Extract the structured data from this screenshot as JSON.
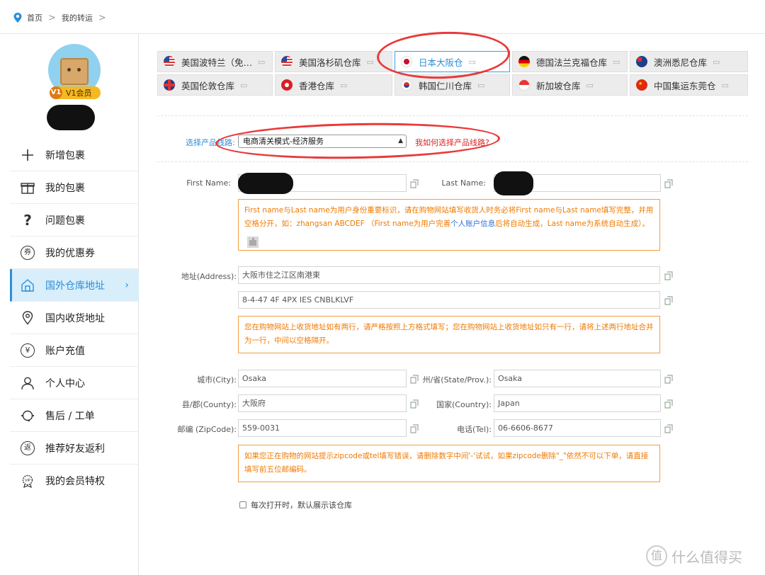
{
  "breadcrumb": {
    "home": "首页",
    "current": "我的转运"
  },
  "user": {
    "vip_badge": "V1会员",
    "vip_letter": "V1"
  },
  "sidebar": {
    "items": [
      {
        "label": "新增包裹",
        "icon": "plus-icon"
      },
      {
        "label": "我的包裹",
        "icon": "gift-box-icon"
      },
      {
        "label": "问题包裹",
        "icon": "question-icon"
      },
      {
        "label": "我的优惠券",
        "icon": "coupon-icon",
        "glyph": "券"
      },
      {
        "label": "国外仓库地址",
        "icon": "warehouse-icon",
        "active": true
      },
      {
        "label": "国内收货地址",
        "icon": "location-icon"
      },
      {
        "label": "账户充值",
        "icon": "yen-icon",
        "glyph": "¥"
      },
      {
        "label": "个人中心",
        "icon": "user-icon"
      },
      {
        "label": "售后 / 工单",
        "icon": "headset-icon"
      },
      {
        "label": "推荐好友返利",
        "icon": "rebate-icon",
        "glyph": "返"
      },
      {
        "label": "我的会员特权",
        "icon": "vip-badge-icon"
      }
    ]
  },
  "tabs": [
    {
      "label": "美国波特兰（免…",
      "flag": "us"
    },
    {
      "label": "美国洛杉矶仓库",
      "flag": "us"
    },
    {
      "label": "日本大阪仓",
      "flag": "jp",
      "active": true
    },
    {
      "label": "德国法兰克福仓库",
      "flag": "de"
    },
    {
      "label": "澳洲悉尼仓库",
      "flag": "au"
    },
    {
      "label": "英国伦敦仓库",
      "flag": "uk"
    },
    {
      "label": "香港仓库",
      "flag": "hk"
    },
    {
      "label": "韩国仁川仓库",
      "flag": "kr"
    },
    {
      "label": "新加坡仓库",
      "flag": "sg"
    },
    {
      "label": "中国集运东莞仓",
      "flag": "cn"
    }
  ],
  "product_line": {
    "label": "选择产品线路:",
    "selected": "电商清关模式-经济服务",
    "help_link": "我如何选择产品线路?"
  },
  "form": {
    "first_name_label": "First Name:",
    "last_name_label": "Last Name:",
    "name_note_1": "First name与Last name为用户身份重要标识，请在购物网站填写收货人时务必将First name与Last name填写完整，并用空格分开，如：zhangsan ABCDEF （First name为用户完善",
    "name_note_link": "个人账户信息",
    "name_note_2": "后将自动生成，Last name为系统自动生成）。",
    "address_label": "地址(Address):",
    "address_line1": "大阪市住之江区南港東",
    "address_line2": "8-4-47 4F 4PX IES CNBLKLVF",
    "address_note": "您在购物网站上收货地址如有两行，请严格按照上方格式填写；您在购物网站上收货地址如只有一行，请将上述两行地址合并为一行，中间以空格隔开。",
    "city_label": "城市(City):",
    "city": "Osaka",
    "state_label": "州/省(State/Prov.):",
    "state": "Osaka",
    "county_label": "县/郡(County):",
    "county": "大阪府",
    "country_label": "国家(Country):",
    "country": "Japan",
    "zip_label": "邮编 (ZipCode):",
    "zip": "559-0031",
    "tel_label": "电话(Tel):",
    "tel": "06-6606-8677",
    "zip_note": "如果您正在购物的网站提示zipcode或tel填写错误，请删除数字中间'-'试试，如果zipcode删除\"_\"依然不可以下单，请直接填写前五位邮编码。",
    "default_checkbox": "每次打开时，默认展示该仓库"
  },
  "watermark": {
    "text": "什么值得买",
    "icon_glyph": "值"
  },
  "colors": {
    "accent": "#2a8fd8",
    "note_orange": "#f07a00",
    "note_border": "#f0a040",
    "help_red": "#dd2222",
    "annotation_red": "#e93a3a"
  }
}
